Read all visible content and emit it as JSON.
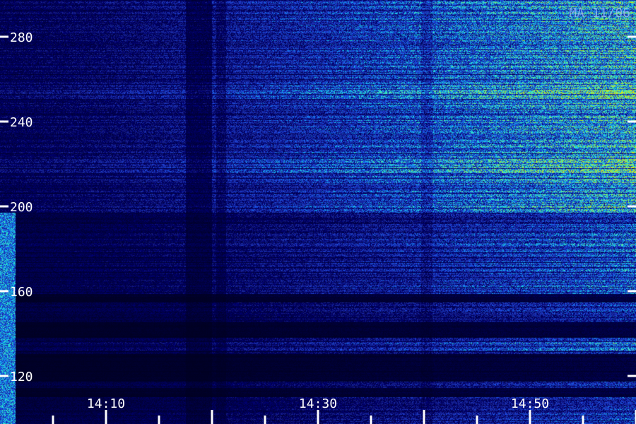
{
  "corner_label": "MA 11/06",
  "y_axis": {
    "ticks": [
      {
        "value": 280,
        "label": "280"
      },
      {
        "value": 240,
        "label": "240"
      },
      {
        "value": 200,
        "label": "200"
      },
      {
        "value": 160,
        "label": "160"
      },
      {
        "value": 120,
        "label": "120"
      }
    ],
    "range": [
      100,
      290
    ]
  },
  "x_axis": {
    "labels": [
      {
        "minute": 10,
        "label": "14:10"
      },
      {
        "minute": 30,
        "label": "14:30"
      },
      {
        "minute": 50,
        "label": "14:50"
      }
    ],
    "minor_tick_minutes": [
      5,
      10,
      15,
      20,
      25,
      30,
      35,
      40,
      45,
      50,
      55,
      60
    ],
    "range": [
      0,
      60
    ]
  },
  "colors": {
    "background": "#000010",
    "dark_blue": "#0a0a60",
    "blue": "#2030d0",
    "cyan": "#20c0e0",
    "green": "#40ff90",
    "tick": "#ffffff"
  }
}
